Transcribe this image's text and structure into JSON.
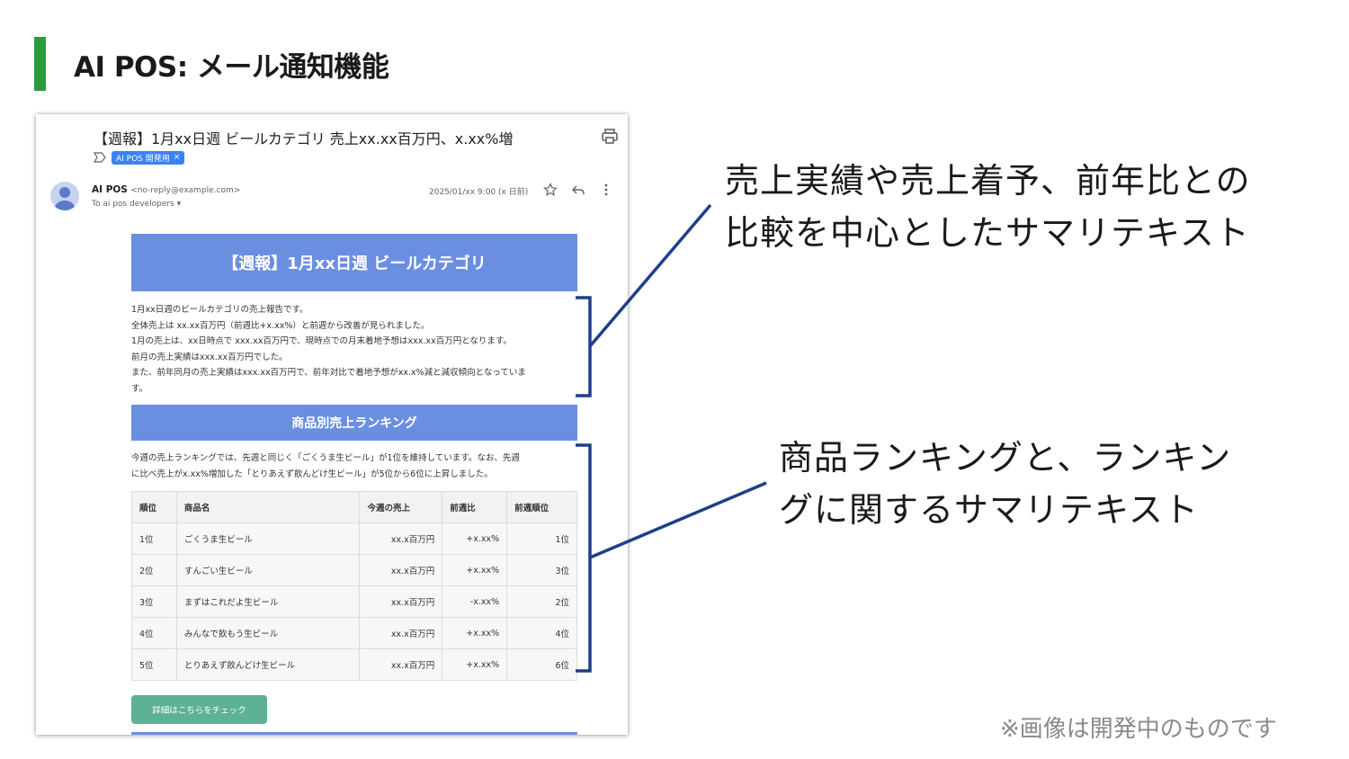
{
  "slide": {
    "title": "AI POS: メール通知機能",
    "accent_color": "#2e9a3e",
    "footnote": "※画像は開発中のものです"
  },
  "email": {
    "subject": "【週報】1月xx日週 ビールカテゴリ 売上xx.xx百万円、x.xx%増",
    "label_chip": "AI POS 開発用",
    "label_close": "×",
    "sender_name": "AI POS",
    "sender_email": "<no-reply@example.com>",
    "recipients": "To ai pos developers ▾",
    "date": "2025/01/xx 9:00 (x 日前)",
    "banner_title": "【週報】1月xx日週 ビールカテゴリ",
    "summary_lines": [
      "1月xx日週のビールカテゴリの売上報告です。",
      "全体売上は xx.xx百万円（前週比+x.xx%）と前週から改善が見られました。",
      "1月の売上は、xx日時点で xxx.xx百万円で、現時点での月末着地予想はxxx.xx百万円となります。",
      "前月の売上実績はxxx.xx百万円でした。",
      "また、前年同月の売上実績はxxx.xx百万円で、前年対比で着地予想がxx.x%減と減収傾向となっていま",
      "す。"
    ],
    "ranking_section_title": "商品別売上ランキング",
    "ranking_text_lines": [
      "今週の売上ランキングでは、先週と同じく「ごくうま生ビール」が1位を維持しています。なお、先週",
      "に比べ売上がx.xx%増加した「とりあえず飲んどけ生ビール」が5位から6位に上昇しました。"
    ],
    "ranking_table": {
      "headers": [
        "順位",
        "商品名",
        "今週の売上",
        "前週比",
        "前週順位"
      ],
      "rows": [
        [
          "1位",
          "ごくうま生ビール",
          "xx.x百万円",
          "+x.xx%",
          "1位"
        ],
        [
          "2位",
          "すんごい生ビール",
          "xx.x百万円",
          "+x.xx%",
          "3位"
        ],
        [
          "3位",
          "まずはこれだよ生ビール",
          "xx.x百万円",
          "-x.xx%",
          "2位"
        ],
        [
          "4位",
          "みんなで飲もう生ビール",
          "xx.x百万円",
          "+x.xx%",
          "4位"
        ],
        [
          "5位",
          "とりあえず飲んどけ生ビール",
          "xx.x百万円",
          "+x.xx%",
          "6位"
        ]
      ]
    },
    "cta_label": "詳細はこちらをチェック",
    "banner_color": "#6b8fe0",
    "cta_color": "#5db196",
    "chip_color": "#3b82f6"
  },
  "callouts": {
    "summary_lines": [
      "売上実績や売上着予、前年比との",
      "比較を中心としたサマリテキスト"
    ],
    "ranking_lines": [
      "商品ランキングと、ランキン",
      "グに関するサマリテキスト"
    ],
    "bracket_color": "#1f3f8a"
  },
  "icons": {
    "print": "printer-icon",
    "label": "label-arrow-icon",
    "avatar": "person-avatar-icon",
    "star": "star-icon",
    "reply": "reply-icon",
    "more": "more-vertical-icon"
  }
}
